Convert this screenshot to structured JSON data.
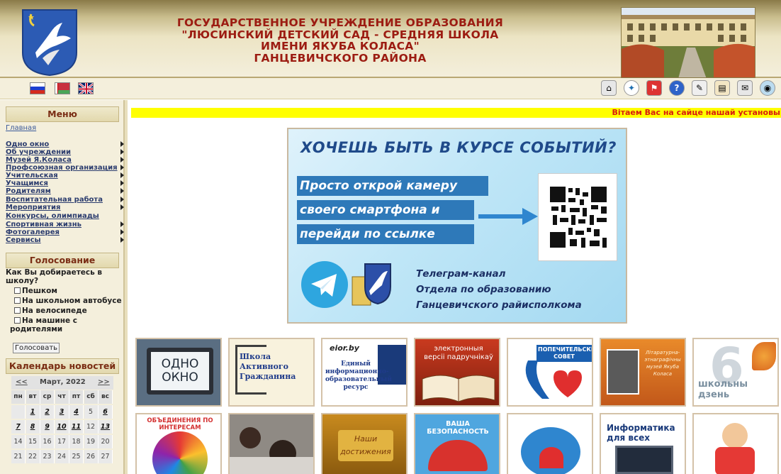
{
  "header": {
    "title_lines": [
      "ГОСУДАРСТВЕННОЕ УЧРЕЖДЕНИЕ ОБРАЗОВАНИЯ",
      "\"ЛЮСИНСКИЙ ДЕТСКИЙ САД - СРЕДНЯЯ ШКОЛА",
      "ИМЕНИ ЯКУБА КОЛАСА\"",
      "ГАНЦЕВИЧСКОГО РАЙОНА"
    ]
  },
  "sidebar": {
    "menu_title": "Меню",
    "home": "Главная",
    "items": [
      "Одно окно",
      "Об учреждении",
      "Музей Я.Коласа",
      "Профсоюзная организация",
      "Учительская",
      "Учащимся",
      "Родителям",
      "Воспитательная работа",
      "Мероприятия",
      "Конкурсы, олимпиады",
      "Спортивная жизнь",
      "Фотогалерея",
      "Сервисы"
    ],
    "poll_title": "Голосование",
    "poll_question": "Как Вы добираетесь в школу?",
    "poll_options": [
      "Пешком",
      "На школьном автобусе",
      "На велосипеде",
      "На машине с родителями"
    ],
    "vote_button": "Голосовать",
    "calendar_title": "Календарь новостей"
  },
  "calendar": {
    "prev": "<<",
    "month": "Март, 2022",
    "next": ">>",
    "weekdays": [
      "пн",
      "вт",
      "ср",
      "чт",
      "пт",
      "сб",
      "вс"
    ],
    "weeks": [
      [
        "",
        "1",
        "2",
        "3",
        "4",
        "5",
        "6"
      ],
      [
        "7",
        "8",
        "9",
        "10",
        "11",
        "12",
        "13"
      ],
      [
        "14",
        "15",
        "16",
        "17",
        "18",
        "19",
        "20"
      ],
      [
        "21",
        "22",
        "23",
        "24",
        "25",
        "26",
        "27"
      ]
    ]
  },
  "ticker": "Вітаем Вас на сайце нашай установы",
  "promo": {
    "headline": "ХОЧЕШЬ БЫТЬ В КУРСЕ СОБЫТИЙ?",
    "lines": [
      "Просто открой камеру",
      "своего смартфона и",
      "перейди по ссылке"
    ],
    "footer": [
      "Телеграм-канал",
      "Отдела по образованию",
      "Ганцевичского райисполкома"
    ]
  },
  "tiles": {
    "odno_okno": "ОДНО ОКНО",
    "school": "Школа Активного Гражданина",
    "eior_site": "eior.by",
    "eior_text": "Единый информационно-образовательный ресурс",
    "books": "электронныя версіі падручнікаў",
    "council": "ПОПЕЧИТЕЛЬСКИЙ СОВЕТ",
    "museum": "Літаратурна-этнаграфічны музей Якуба Коласа",
    "sixth_digit": "6",
    "sixth_text": "школьны дзень",
    "interests": "ОБЪЕДИНЕНИЯ ПО ИНТЕРЕСАМ",
    "achievements": "Наши достижения",
    "safety": "ВАША БЕЗОПАСНОСТЬ",
    "informatics": "Информатика для всех"
  },
  "colors": {
    "title": "#9c1c12",
    "ticker_bg": "#ffff00",
    "ticker_text": "#d81b0f",
    "sidebar_bg": "#f4efdc"
  }
}
